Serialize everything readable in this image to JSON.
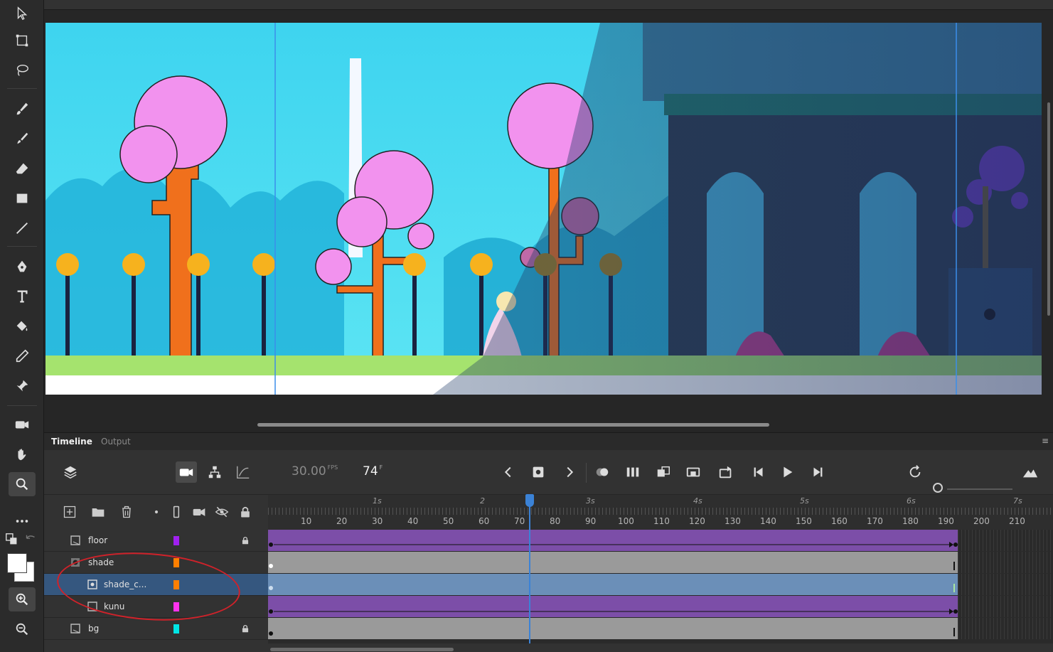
{
  "stage": {
    "scene": {
      "sky_color": "#38d6ee",
      "tree_pink": "#f292ee",
      "trunk_orange": "#f0701c",
      "lamp_yellow": "#f6b21e",
      "grass_green": "#a5e36e",
      "building_dark": "#2b3a4a"
    },
    "selection_color": "#3b8eea"
  },
  "timeline_panel": {
    "tabs": [
      "Timeline",
      "Output"
    ],
    "fps_value": "30.00",
    "fps_unit": "FPS",
    "current_frame": "74",
    "frame_unit": "F"
  },
  "ruler": {
    "seconds": [
      "1s",
      "2",
      "3s",
      "4s",
      "5s",
      "6s",
      "7s"
    ],
    "ticks": [
      "10",
      "20",
      "30",
      "40",
      "50",
      "60",
      "70",
      "80",
      "90",
      "100",
      "110",
      "120",
      "130",
      "140",
      "150",
      "160",
      "170",
      "180",
      "190",
      "200",
      "210"
    ]
  },
  "layers": [
    {
      "name": "floor",
      "color": "#a020f0",
      "locked": true,
      "indent": 0
    },
    {
      "name": "shade",
      "color": "#ff7f00",
      "locked": false,
      "indent": 0
    },
    {
      "name": "shade_c...",
      "color": "#ff7f00",
      "locked": false,
      "indent": 1,
      "selected": true
    },
    {
      "name": "kunu",
      "color": "#ff33ee",
      "locked": false,
      "indent": 1
    },
    {
      "name": "bg",
      "color": "#00e5e5",
      "locked": true,
      "indent": 0
    }
  ],
  "colors": {
    "accent": "#3b82d6",
    "tween_purple": "#7c4ea8",
    "tween_gray": "#9a9a9a",
    "tween_blue": "#6b8fb8",
    "annotation_red": "#d0222a"
  }
}
